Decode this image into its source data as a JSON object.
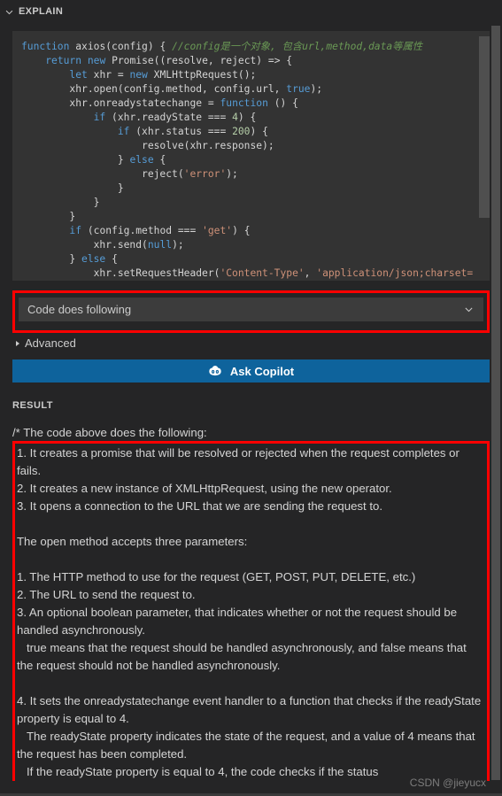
{
  "panel": {
    "section_title": "EXPLAIN",
    "collapse_icon": "chevron-down-icon"
  },
  "code_block": {
    "language": "javascript",
    "lines": [
      "function axios(config) { //config是一个对象, 包含url,method,data等属性",
      "    return new Promise((resolve, reject) => {",
      "        let xhr = new XMLHttpRequest();",
      "        xhr.open(config.method, config.url, true);",
      "        xhr.onreadystatechange = function () {",
      "            if (xhr.readyState === 4) {",
      "                if (xhr.status === 200) {",
      "                    resolve(xhr.response);",
      "                } else {",
      "                    reject('error');",
      "                }",
      "            }",
      "        }",
      "        if (config.method === 'get') {",
      "            xhr.send(null);",
      "        } else {",
      "            xhr.setRequestHeader('Content-Type', 'application/json;charset="
    ]
  },
  "prompt_select": {
    "value": "Code does following",
    "chevron_icon": "chevron-down-icon",
    "highlight_color": "#fe0000"
  },
  "advanced": {
    "label": "Advanced",
    "expand_icon": "triangle-right-icon"
  },
  "ask_button": {
    "label": "Ask Copilot",
    "icon": "copilot-icon",
    "color": "#0e639c"
  },
  "result": {
    "header": "RESULT",
    "intro": "/* The code above does the following:",
    "body": "1. It creates a promise that will be resolved or rejected when the request completes or fails.\n2. It creates a new instance of XMLHttpRequest, using the new operator.\n3. It opens a connection to the URL that we are sending the request to.\n\nThe open method accepts three parameters:\n\n1. The HTTP method to use for the request (GET, POST, PUT, DELETE, etc.)\n2. The URL to send the request to.\n3. An optional boolean parameter, that indicates whether or not the request should be handled asynchronously.\n   true means that the request should be handled asynchronously, and false means that the request should not be handled asynchronously.\n\n4. It sets the onreadystatechange event handler to a function that checks if the readyState property is equal to 4.\n   The readyState property indicates the state of the request, and a value of 4 means that the request has been completed.\n   If the readyState property is equal to 4, the code checks if the status",
    "highlight_color": "#fe0000"
  },
  "watermark": {
    "text": "CSDN @jieyucx"
  }
}
